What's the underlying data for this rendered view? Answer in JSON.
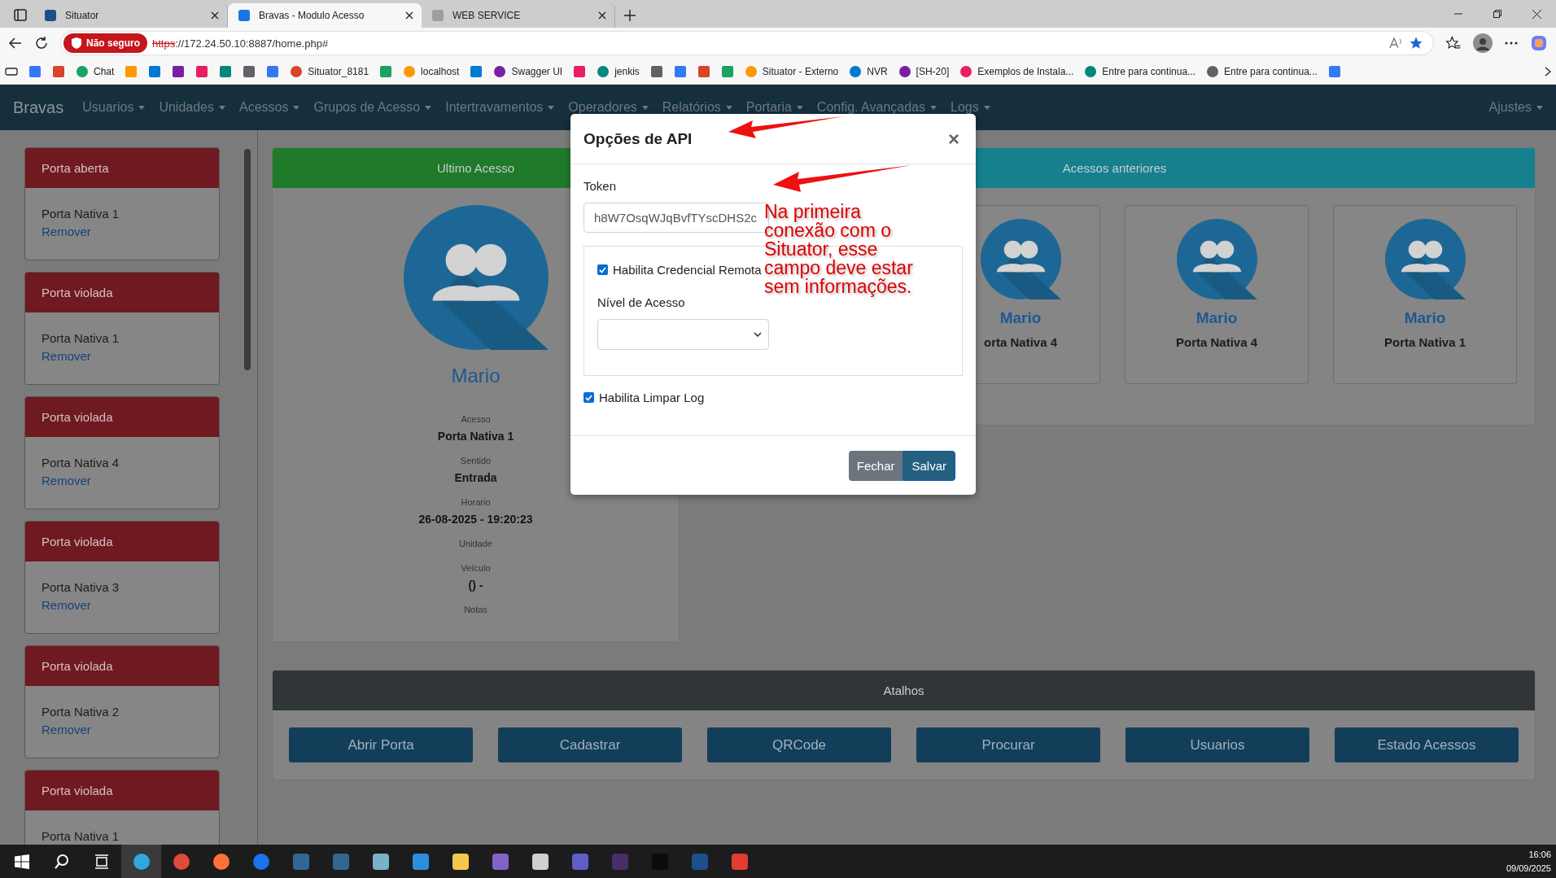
{
  "browser": {
    "tabs": [
      {
        "title": "Situator",
        "selected": false
      },
      {
        "title": "Bravas - Modulo Acesso",
        "selected": true
      },
      {
        "title": "WEB SERVICE",
        "selected": false
      }
    ],
    "security_badge": "Não seguro",
    "url_scheme": "https",
    "url_rest": "://172.24.50.10:8887/home.php#",
    "bookmarks": [
      {
        "kind": "icon"
      },
      {
        "kind": "icon"
      },
      {
        "kind": "link",
        "label": "Chat"
      },
      {
        "kind": "icon"
      },
      {
        "kind": "icon"
      },
      {
        "kind": "icon"
      },
      {
        "kind": "icon"
      },
      {
        "kind": "icon"
      },
      {
        "kind": "icon"
      },
      {
        "kind": "icon"
      },
      {
        "kind": "link",
        "label": "Situator_8181"
      },
      {
        "kind": "icon"
      },
      {
        "kind": "link",
        "label": "localhost"
      },
      {
        "kind": "icon"
      },
      {
        "kind": "link",
        "label": "Swagger UI"
      },
      {
        "kind": "icon"
      },
      {
        "kind": "link",
        "label": "jenkis"
      },
      {
        "kind": "icon"
      },
      {
        "kind": "icon"
      },
      {
        "kind": "icon"
      },
      {
        "kind": "icon"
      },
      {
        "kind": "link",
        "label": "Situator - Externo"
      },
      {
        "kind": "link",
        "label": "NVR"
      },
      {
        "kind": "link",
        "label": "[SH-20]"
      },
      {
        "kind": "link",
        "label": "Exemplos de Instala..."
      },
      {
        "kind": "link",
        "label": "Entre para continua..."
      },
      {
        "kind": "link",
        "label": "Entre para continua..."
      },
      {
        "kind": "icon"
      }
    ]
  },
  "navbar": {
    "brand": "Bravas",
    "items": [
      "Usuarios",
      "Unidades",
      "Acessos",
      "Grupos de Acesso",
      "Intertravamentos",
      "Operadores",
      "Relatórios",
      "Portaria",
      "Config. Avançadas",
      "Logs"
    ],
    "right_item": "Ajustes"
  },
  "sidebar": {
    "cards": [
      {
        "status": "Porta aberta",
        "door": "Porta Nativa 1",
        "action": "Remover"
      },
      {
        "status": "Porta violada",
        "door": "Porta Nativa 1",
        "action": "Remover"
      },
      {
        "status": "Porta violada",
        "door": "Porta Nativa 4",
        "action": "Remover"
      },
      {
        "status": "Porta violada",
        "door": "Porta Nativa 3",
        "action": "Remover"
      },
      {
        "status": "Porta violada",
        "door": "Porta Nativa 2",
        "action": "Remover"
      },
      {
        "status": "Porta violada",
        "door": "Porta Nativa 1"
      }
    ]
  },
  "last_access": {
    "title": "Ultimo Acesso",
    "name": "Mario",
    "fields": [
      {
        "label": "Acesso",
        "value": "Porta Nativa 1"
      },
      {
        "label": "Sentido",
        "value": "Entrada"
      },
      {
        "label": "Horario",
        "value": "26-08-2025 - 19:20:23"
      },
      {
        "label": "Unidade"
      },
      {
        "label": "Veículo",
        "value": "() -"
      },
      {
        "label": "Notas"
      }
    ]
  },
  "previous_accesses": {
    "title": "Acessos anteriores",
    "cards": [
      {
        "name": "Mario",
        "door": "orta Nativa 4"
      },
      {
        "name": "Mario",
        "door": "Porta Nativa 4"
      },
      {
        "name": "Mario",
        "door": "Porta Nativa 1"
      }
    ]
  },
  "shortcuts": {
    "title": "Atalhos",
    "buttons": [
      "Abrir Porta",
      "Cadastrar",
      "QRCode",
      "Procurar",
      "Usuarios",
      "Estado Acessos"
    ]
  },
  "modal": {
    "title": "Opções de API",
    "close": "×",
    "token": {
      "label": "Token",
      "value": "h8W7OsqWJqBvfTYscDHS2c"
    },
    "remote_credential": {
      "label": "Habilita Credencial Remota",
      "checked": true
    },
    "access_level": {
      "label": "Nível de Acesso"
    },
    "clear_log": {
      "label": "Habilita Limpar Log",
      "checked": true
    },
    "buttons": [
      {
        "label": "Fechar",
        "kind": "secondary"
      },
      {
        "label": "Salvar",
        "kind": "primary"
      }
    ],
    "annotation": "Na primeira conexão com o Situator, esse campo deve estar sem informações."
  },
  "taskbar": {
    "time": "16:06",
    "date": "09/09/2025"
  }
}
